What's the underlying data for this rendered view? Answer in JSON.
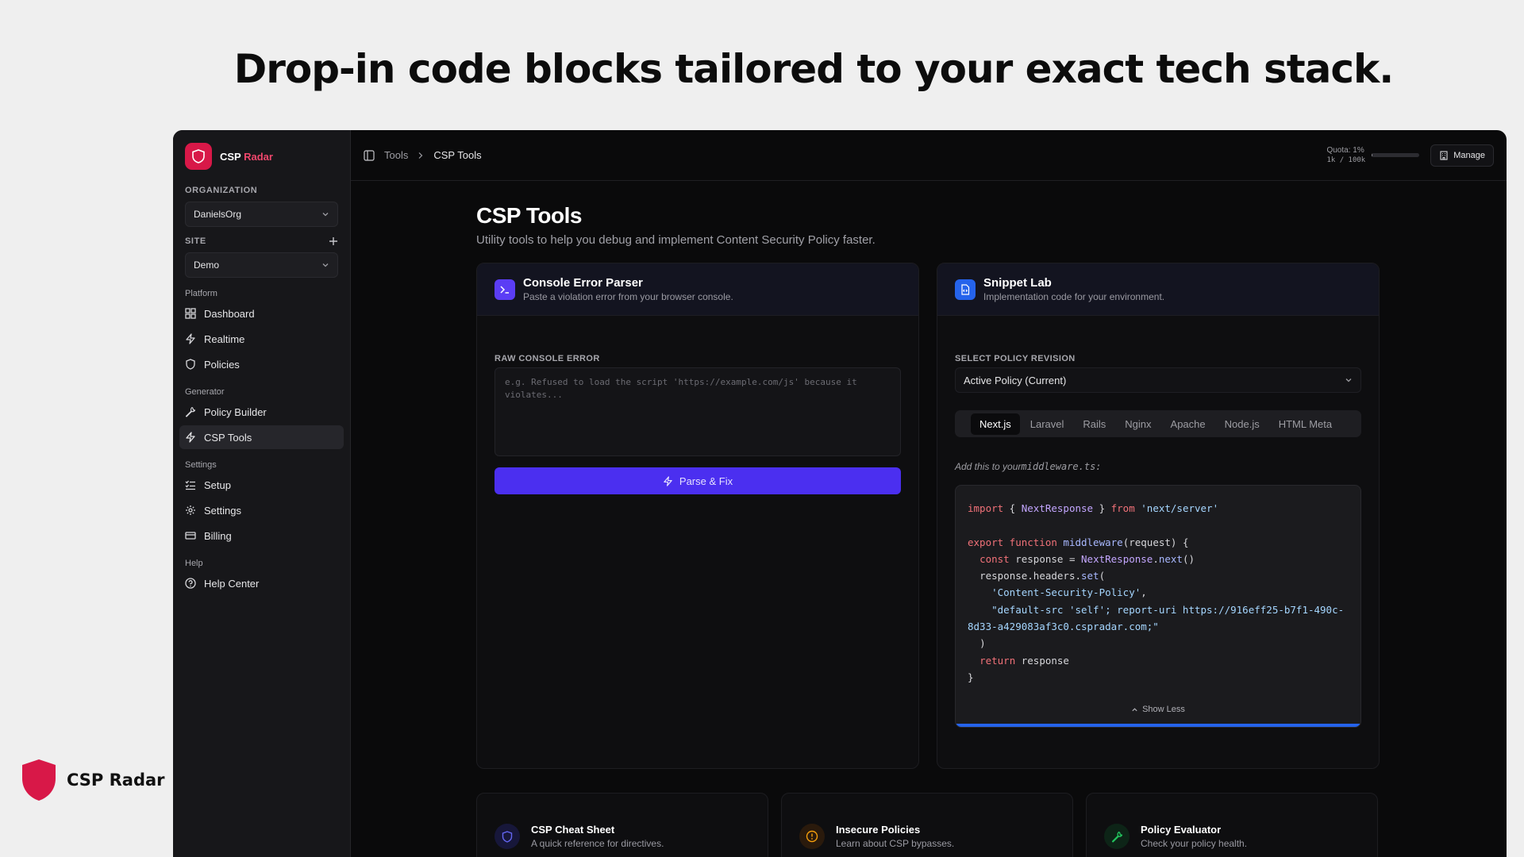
{
  "headline": "Drop-in code blocks tailored to your exact tech stack.",
  "brand": {
    "name": "CSP Radar",
    "logo_first": "CSP",
    "logo_accent": "Radar",
    "accent_color": "#d81848"
  },
  "sidebar": {
    "org_label": "ORGANIZATION",
    "org_value": "DanielsOrg",
    "site_label": "SITE",
    "site_value": "Demo",
    "groups": [
      {
        "label": "Platform",
        "items": [
          {
            "label": "Dashboard",
            "icon": "grid-icon"
          },
          {
            "label": "Realtime",
            "icon": "bolt-icon"
          },
          {
            "label": "Policies",
            "icon": "shield-icon"
          }
        ]
      },
      {
        "label": "Generator",
        "items": [
          {
            "label": "Policy Builder",
            "icon": "wrench-icon"
          },
          {
            "label": "CSP Tools",
            "icon": "bolt-icon",
            "active": true
          }
        ]
      },
      {
        "label": "Settings",
        "items": [
          {
            "label": "Setup",
            "icon": "checklist-icon"
          },
          {
            "label": "Settings",
            "icon": "gear-icon"
          },
          {
            "label": "Billing",
            "icon": "card-icon"
          }
        ]
      },
      {
        "label": "Help",
        "items": [
          {
            "label": "Help Center",
            "icon": "help-icon"
          }
        ]
      }
    ]
  },
  "topbar": {
    "breadcrumb": [
      "Tools",
      "CSP Tools"
    ],
    "quota_label": "Quota: 1%",
    "quota_detail": "1k / 100k",
    "quota_fraction": 0.01,
    "manage_label": "Manage"
  },
  "page": {
    "title": "CSP Tools",
    "subtitle": "Utility tools to help you debug and implement Content Security Policy faster."
  },
  "parser": {
    "title": "Console Error Parser",
    "desc": "Paste a violation error from your browser console.",
    "field_label": "RAW CONSOLE ERROR",
    "placeholder": "e.g. Refused to load the script 'https://example.com/js' because it violates...",
    "button": "Parse & Fix"
  },
  "snippet": {
    "title": "Snippet Lab",
    "desc": "Implementation code for your environment.",
    "field_label": "SELECT POLICY REVISION",
    "revision": "Active Policy (Current)",
    "tabs": [
      "Next.js",
      "Laravel",
      "Rails",
      "Nginx",
      "Apache",
      "Node.js",
      "HTML Meta"
    ],
    "active_tab": "Next.js",
    "hint_prefix": "Add this to your",
    "hint_file": "middleware.ts:",
    "show_less": "Show Less"
  },
  "bottom_cards": [
    {
      "title": "CSP Cheat Sheet",
      "desc": "A quick reference for directives.",
      "icon": "shield-icon",
      "color": "#4f46e5"
    },
    {
      "title": "Insecure Policies",
      "desc": "Learn about CSP bypasses.",
      "icon": "alert-icon",
      "color": "#f59e0b"
    },
    {
      "title": "Policy Evaluator",
      "desc": "Check your policy health.",
      "icon": "wrench-icon",
      "color": "#22c55e"
    }
  ]
}
